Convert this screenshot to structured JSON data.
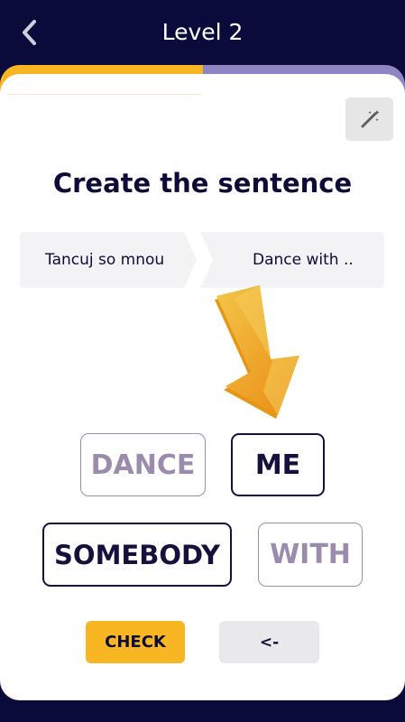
{
  "header": {
    "title": "Level 2",
    "back_icon": "chevron-left-icon"
  },
  "progress": {
    "value": 0.5,
    "fill_color": "#f8b722",
    "track_color": "#8e86c4"
  },
  "hint_button": {
    "icon": "magic-wand-icon"
  },
  "exercise": {
    "heading": "Create the sentence",
    "source_phrase": "Tancuj so mnou",
    "target_phrase": "Dance with ..",
    "arrow_icon": "arrow-down-icon"
  },
  "word_tiles": [
    {
      "label": "DANCE",
      "state": "used"
    },
    {
      "label": "ME",
      "state": "available"
    },
    {
      "label": "SOMEBODY",
      "state": "available"
    },
    {
      "label": "WITH",
      "state": "used"
    }
  ],
  "actions": {
    "check_label": "CHECK",
    "backspace_label": "<-"
  },
  "colors": {
    "background": "#0b0b3b",
    "accent": "#f8b722",
    "text_dark": "#0d0c38",
    "used_tile_text": "#9b8cae"
  }
}
